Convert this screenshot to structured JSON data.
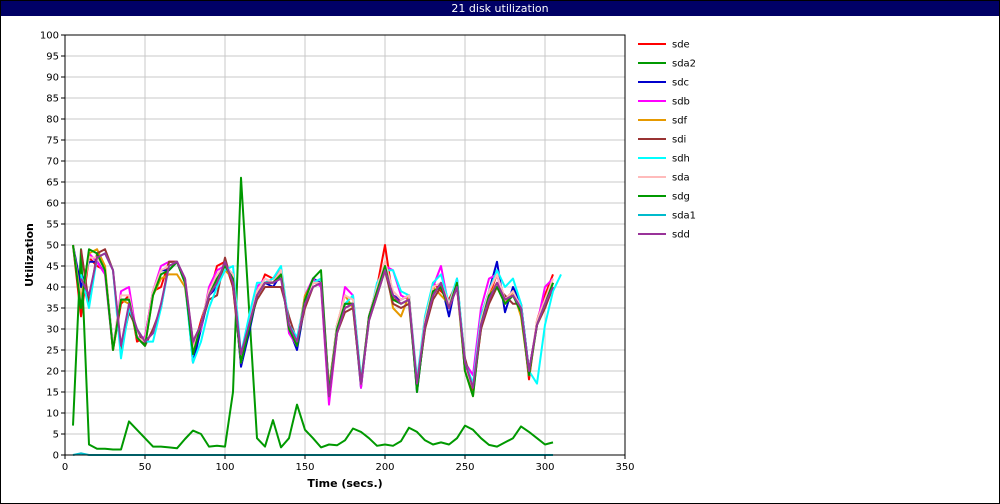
{
  "window": {
    "title": "21 disk utilization"
  },
  "chart_data": {
    "type": "line",
    "title": "21 disk utilization",
    "xlabel": "Time (secs.)",
    "ylabel": "Utilization",
    "xlim": [
      0,
      350
    ],
    "ylim": [
      0,
      100
    ],
    "xticks": [
      0,
      50,
      100,
      150,
      200,
      250,
      300,
      350
    ],
    "yticks": [
      0,
      5,
      10,
      15,
      20,
      25,
      30,
      35,
      40,
      45,
      50,
      55,
      60,
      65,
      70,
      75,
      80,
      85,
      90,
      95,
      100
    ],
    "grid": true,
    "legend_position": "right",
    "x": [
      5,
      10,
      15,
      20,
      25,
      30,
      35,
      40,
      45,
      50,
      55,
      60,
      65,
      70,
      75,
      80,
      85,
      90,
      95,
      100,
      105,
      110,
      115,
      120,
      125,
      130,
      135,
      140,
      145,
      150,
      155,
      160,
      165,
      170,
      175,
      180,
      185,
      190,
      195,
      200,
      205,
      210,
      215,
      220,
      225,
      230,
      235,
      240,
      245,
      250,
      255,
      260,
      265,
      270,
      275,
      280,
      285,
      290,
      295,
      300,
      305,
      310
    ],
    "series": [
      {
        "name": "sde",
        "color": "#ff0000",
        "values": [
          50,
          33,
          47,
          45,
          44,
          25,
          36,
          38,
          27,
          28,
          39,
          40,
          46,
          46,
          41,
          25,
          32,
          38,
          45,
          46,
          40,
          22,
          30,
          38,
          43,
          42,
          44,
          30,
          27,
          37,
          41,
          41,
          15,
          31,
          35,
          36,
          17,
          33,
          40,
          50,
          37,
          37,
          38,
          16,
          30,
          41,
          39,
          37,
          41,
          20,
          15,
          30,
          38,
          43,
          37,
          39,
          35,
          18,
          32,
          38,
          43,
          null
        ]
      },
      {
        "name": "sda2",
        "color": "#009900",
        "values": [
          7,
          49,
          2.5,
          1.5,
          1.5,
          1.3,
          1.3,
          8,
          6,
          4,
          2,
          2,
          1.8,
          1.6,
          3.8,
          5.8,
          5,
          2,
          2.2,
          2,
          15,
          66,
          35,
          4,
          2,
          8.3,
          1.8,
          4,
          12,
          6,
          4,
          1.8,
          2.5,
          2.3,
          3.5,
          6.3,
          5.5,
          4,
          2.2,
          2.5,
          2.2,
          3.3,
          6.5,
          5.5,
          3.5,
          2.5,
          3,
          2.5,
          4,
          7,
          6,
          4,
          2.4,
          2,
          3,
          4,
          6.8,
          5.5,
          4,
          2.5,
          3,
          null
        ]
      },
      {
        "name": "sdc",
        "color": "#0000cc",
        "values": [
          50,
          40,
          46,
          46,
          44,
          26,
          37,
          37,
          28,
          26,
          39,
          44,
          44,
          46,
          42,
          22,
          30,
          38,
          40,
          46,
          42,
          21,
          29,
          38,
          41,
          40,
          43,
          30,
          25,
          36,
          42,
          41,
          16,
          30,
          36,
          36,
          16,
          33,
          40,
          45,
          38,
          37,
          38,
          15,
          31,
          38,
          41,
          33,
          42,
          21,
          16,
          33,
          39,
          46,
          34,
          40,
          36,
          20,
          31,
          36,
          41,
          null
        ]
      },
      {
        "name": "sdb",
        "color": "#ff00ff",
        "values": [
          50,
          36,
          48,
          46,
          43,
          25,
          39,
          40,
          28,
          28,
          39,
          45,
          46,
          46,
          42,
          26,
          30,
          40,
          44,
          45,
          43,
          22,
          31,
          40,
          42,
          41,
          44,
          29,
          26,
          38,
          42,
          40,
          12,
          29,
          40,
          38,
          16,
          33,
          40,
          45,
          44,
          38,
          37,
          17,
          32,
          40,
          45,
          35,
          40,
          22,
          19,
          35,
          42,
          43,
          36,
          38,
          36,
          20,
          31,
          40,
          42,
          null
        ]
      },
      {
        "name": "sdf",
        "color": "#e69900",
        "values": [
          50,
          37,
          48,
          49,
          45,
          25,
          37,
          36,
          28,
          26,
          38,
          42,
          43,
          43,
          40,
          25,
          31,
          39,
          41,
          44,
          42,
          22,
          31,
          39,
          41,
          41,
          43,
          30,
          27,
          38,
          41,
          42,
          16,
          31,
          38,
          35,
          17,
          33,
          38,
          46,
          35,
          33,
          38,
          16,
          32,
          40,
          38,
          36,
          40,
          20,
          14,
          32,
          38,
          41,
          36,
          39,
          33,
          19,
          31,
          35,
          41,
          null
        ]
      },
      {
        "name": "sdi",
        "color": "#993333",
        "values": [
          null,
          49,
          36,
          48,
          49,
          44,
          25,
          34,
          30,
          26,
          30,
          35,
          46,
          46,
          41,
          27,
          31,
          37,
          38,
          47,
          40,
          23,
          31,
          37,
          40,
          40,
          40,
          33,
          27,
          35,
          40,
          41,
          14,
          29,
          34,
          35,
          17,
          32,
          38,
          44,
          36,
          35,
          36,
          16,
          30,
          37,
          40,
          35,
          40,
          23,
          16,
          30,
          36,
          40,
          38,
          36,
          36,
          20,
          31,
          35,
          40,
          null
        ]
      },
      {
        "name": "sdh",
        "color": "#00ffff",
        "values": [
          null,
          43,
          35,
          47,
          48,
          44,
          23,
          35,
          30,
          27,
          27,
          35,
          45,
          46,
          41,
          22,
          27,
          35,
          40,
          44,
          45,
          24,
          33,
          41,
          41,
          42,
          45,
          31,
          28,
          37,
          41,
          42,
          15,
          31,
          36,
          38,
          18,
          32,
          41,
          44,
          44,
          39,
          38,
          18,
          33,
          41,
          43,
          36,
          42,
          22,
          17,
          33,
          39,
          44,
          40,
          42,
          36,
          20,
          17,
          31,
          39,
          43
        ]
      },
      {
        "name": "sda",
        "color": "#ffbbbb",
        "values": [
          50,
          36,
          47,
          47,
          44,
          26,
          38,
          38,
          28,
          27,
          39,
          44,
          45,
          46,
          42,
          25,
          31,
          39,
          43,
          45,
          43,
          22,
          31,
          39,
          42,
          41,
          44,
          30,
          27,
          37,
          41,
          41,
          15,
          31,
          38,
          37,
          17,
          33,
          40,
          46,
          39,
          37,
          38,
          17,
          32,
          40,
          41,
          36,
          41,
          21,
          16,
          32,
          39,
          43,
          37,
          39,
          35,
          19,
          32,
          37,
          42,
          null
        ]
      },
      {
        "name": "sdg",
        "color": "#009900",
        "values": [
          50,
          35,
          49,
          48,
          44,
          25,
          37,
          37,
          28,
          26,
          38,
          43,
          44,
          46,
          41,
          24,
          31,
          38,
          42,
          45,
          42,
          22,
          30,
          38,
          41,
          41,
          43,
          30,
          26,
          37,
          42,
          44,
          15,
          30,
          36,
          36,
          17,
          33,
          39,
          45,
          37,
          36,
          37,
          15,
          31,
          39,
          40,
          35,
          41,
          20,
          14,
          31,
          38,
          40,
          36,
          38,
          34,
          19,
          31,
          36,
          41,
          null
        ]
      },
      {
        "name": "sda1",
        "color": "#00bbcc",
        "values": [
          0,
          0.4,
          0,
          0,
          0,
          0,
          0,
          0,
          0,
          0,
          0,
          0,
          0,
          0,
          0,
          0,
          0,
          0,
          0,
          0,
          0,
          0,
          0,
          0,
          0,
          0,
          0,
          0,
          0,
          0,
          0,
          0,
          0,
          0,
          0,
          0,
          0,
          0,
          0,
          0,
          0,
          0,
          0,
          0,
          0,
          0,
          0,
          0,
          0,
          0,
          0,
          0,
          0,
          0,
          0,
          0,
          0,
          0,
          0,
          0,
          0,
          null
        ]
      },
      {
        "name": "sdd",
        "color": "#993399",
        "values": [
          null,
          42,
          38,
          47,
          48,
          44,
          26,
          36,
          30,
          27,
          29,
          36,
          45,
          46,
          42,
          27,
          31,
          38,
          41,
          46,
          41,
          24,
          31,
          38,
          41,
          41,
          42,
          31,
          27,
          36,
          40,
          41,
          14,
          29,
          35,
          36,
          17,
          32,
          38,
          44,
          38,
          36,
          37,
          17,
          31,
          38,
          41,
          35,
          40,
          22,
          16,
          31,
          37,
          41,
          37,
          38,
          35,
          20,
          31,
          36,
          40,
          null
        ]
      }
    ]
  }
}
